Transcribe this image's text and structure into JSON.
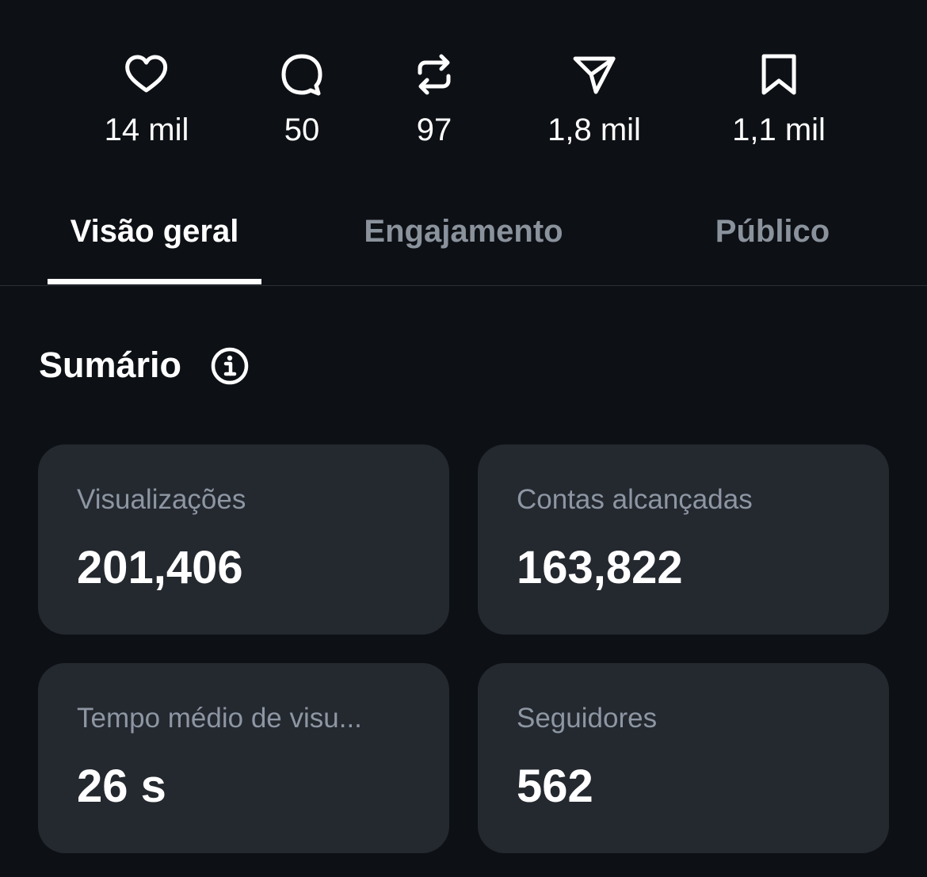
{
  "stats": [
    {
      "icon": "heart-icon",
      "count": "14 mil"
    },
    {
      "icon": "comment-icon",
      "count": "50"
    },
    {
      "icon": "repost-icon",
      "count": "97"
    },
    {
      "icon": "share-icon",
      "count": "1,8 mil"
    },
    {
      "icon": "bookmark-icon",
      "count": "1,1 mil"
    }
  ],
  "tabs": [
    {
      "label": "Visão geral",
      "active": true
    },
    {
      "label": "Engajamento",
      "active": false
    },
    {
      "label": "Público",
      "active": false
    }
  ],
  "summary": {
    "title": "Sumário",
    "info_icon": "info-icon",
    "cards": [
      {
        "label": "Visualizações",
        "value": "201,406"
      },
      {
        "label": "Contas alcançadas",
        "value": "163,822"
      },
      {
        "label": "Tempo médio de visu...",
        "value": "26 s"
      },
      {
        "label": "Seguidores",
        "value": "562"
      }
    ]
  },
  "colors": {
    "background": "#0d1015",
    "card": "#24282f",
    "text_primary": "#ffffff",
    "text_secondary": "#8d96a2",
    "divider": "#2a2f36"
  }
}
